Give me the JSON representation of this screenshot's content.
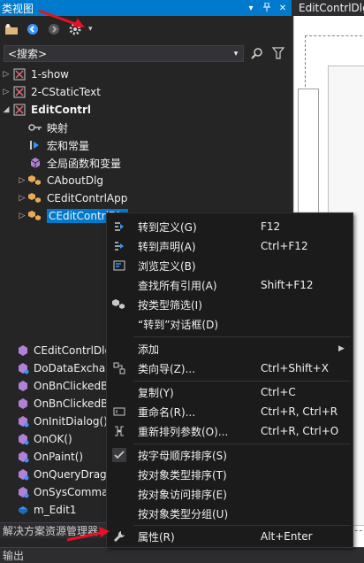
{
  "class_view": {
    "title": "类视图",
    "search_placeholder": "<搜索>",
    "tree": [
      {
        "label": "1-show",
        "expanded": false
      },
      {
        "label": "2-CStaticText",
        "expanded": false
      },
      {
        "label": "EditContrl",
        "expanded": true,
        "bold": true
      },
      {
        "label": "映射"
      },
      {
        "label": "宏和常量"
      },
      {
        "label": "全局函数和变量"
      },
      {
        "label": "CAboutDlg",
        "expanded": false
      },
      {
        "label": "CEditContrlApp",
        "expanded": false
      },
      {
        "label": "CEditContrlDlg",
        "expanded": false,
        "selected": true
      }
    ],
    "members": [
      "CEditContrlDlg",
      "DoDataExchan",
      "OnBnClickedB",
      "OnBnClickedB",
      "OnInitDialog()",
      "OnOK()",
      "OnPaint()",
      "OnQueryDragI",
      "OnSysComman",
      "m_Edit1"
    ]
  },
  "tabs": {
    "solution_explorer": "解决方案资源管理器",
    "output": "输出"
  },
  "editor": {
    "tab": "EditContrlDlg"
  },
  "context_menu": {
    "items": [
      {
        "label": "转到定义(G)",
        "shortcut": "F12",
        "icon": "goto-definition-icon"
      },
      {
        "label": "转到声明(A)",
        "shortcut": "Ctrl+F12",
        "icon": "goto-declaration-icon"
      },
      {
        "label": "浏览定义(B)",
        "shortcut": "",
        "icon": "browse-definition-icon"
      },
      {
        "label": "查找所有引用(A)",
        "shortcut": "Shift+F12",
        "icon": ""
      },
      {
        "label": "按类型筛选(I)",
        "shortcut": "",
        "icon": "filter-type-icon"
      },
      {
        "label": "“转到”对话框(D)",
        "shortcut": "",
        "icon": ""
      },
      {
        "label": "添加",
        "shortcut": "",
        "icon": "",
        "submenu": true
      },
      {
        "label": "类向导(Z)...",
        "shortcut": "Ctrl+Shift+X",
        "icon": "class-wizard-icon"
      },
      {
        "label": "复制(Y)",
        "shortcut": "Ctrl+C",
        "icon": ""
      },
      {
        "label": "重命名(R)...",
        "shortcut": "Ctrl+R, Ctrl+R",
        "icon": "rename-icon"
      },
      {
        "label": "重新排列参数(O)...",
        "shortcut": "Ctrl+R, Ctrl+O",
        "icon": "reorder-params-icon"
      },
      {
        "label": "按字母顺序排序(S)",
        "shortcut": "",
        "icon": "check-icon"
      },
      {
        "label": "按对象类型排序(T)",
        "shortcut": "",
        "icon": ""
      },
      {
        "label": "按对象访问排序(E)",
        "shortcut": "",
        "icon": ""
      },
      {
        "label": "按对象类型分组(U)",
        "shortcut": "",
        "icon": ""
      },
      {
        "label": "属性(R)",
        "shortcut": "Alt+Enter",
        "icon": "wrench-icon"
      }
    ]
  },
  "colors": {
    "accent": "#007acc",
    "panel_bg": "#252526",
    "menu_bg": "#1b1b1c",
    "annotation_red": "#e81123"
  }
}
